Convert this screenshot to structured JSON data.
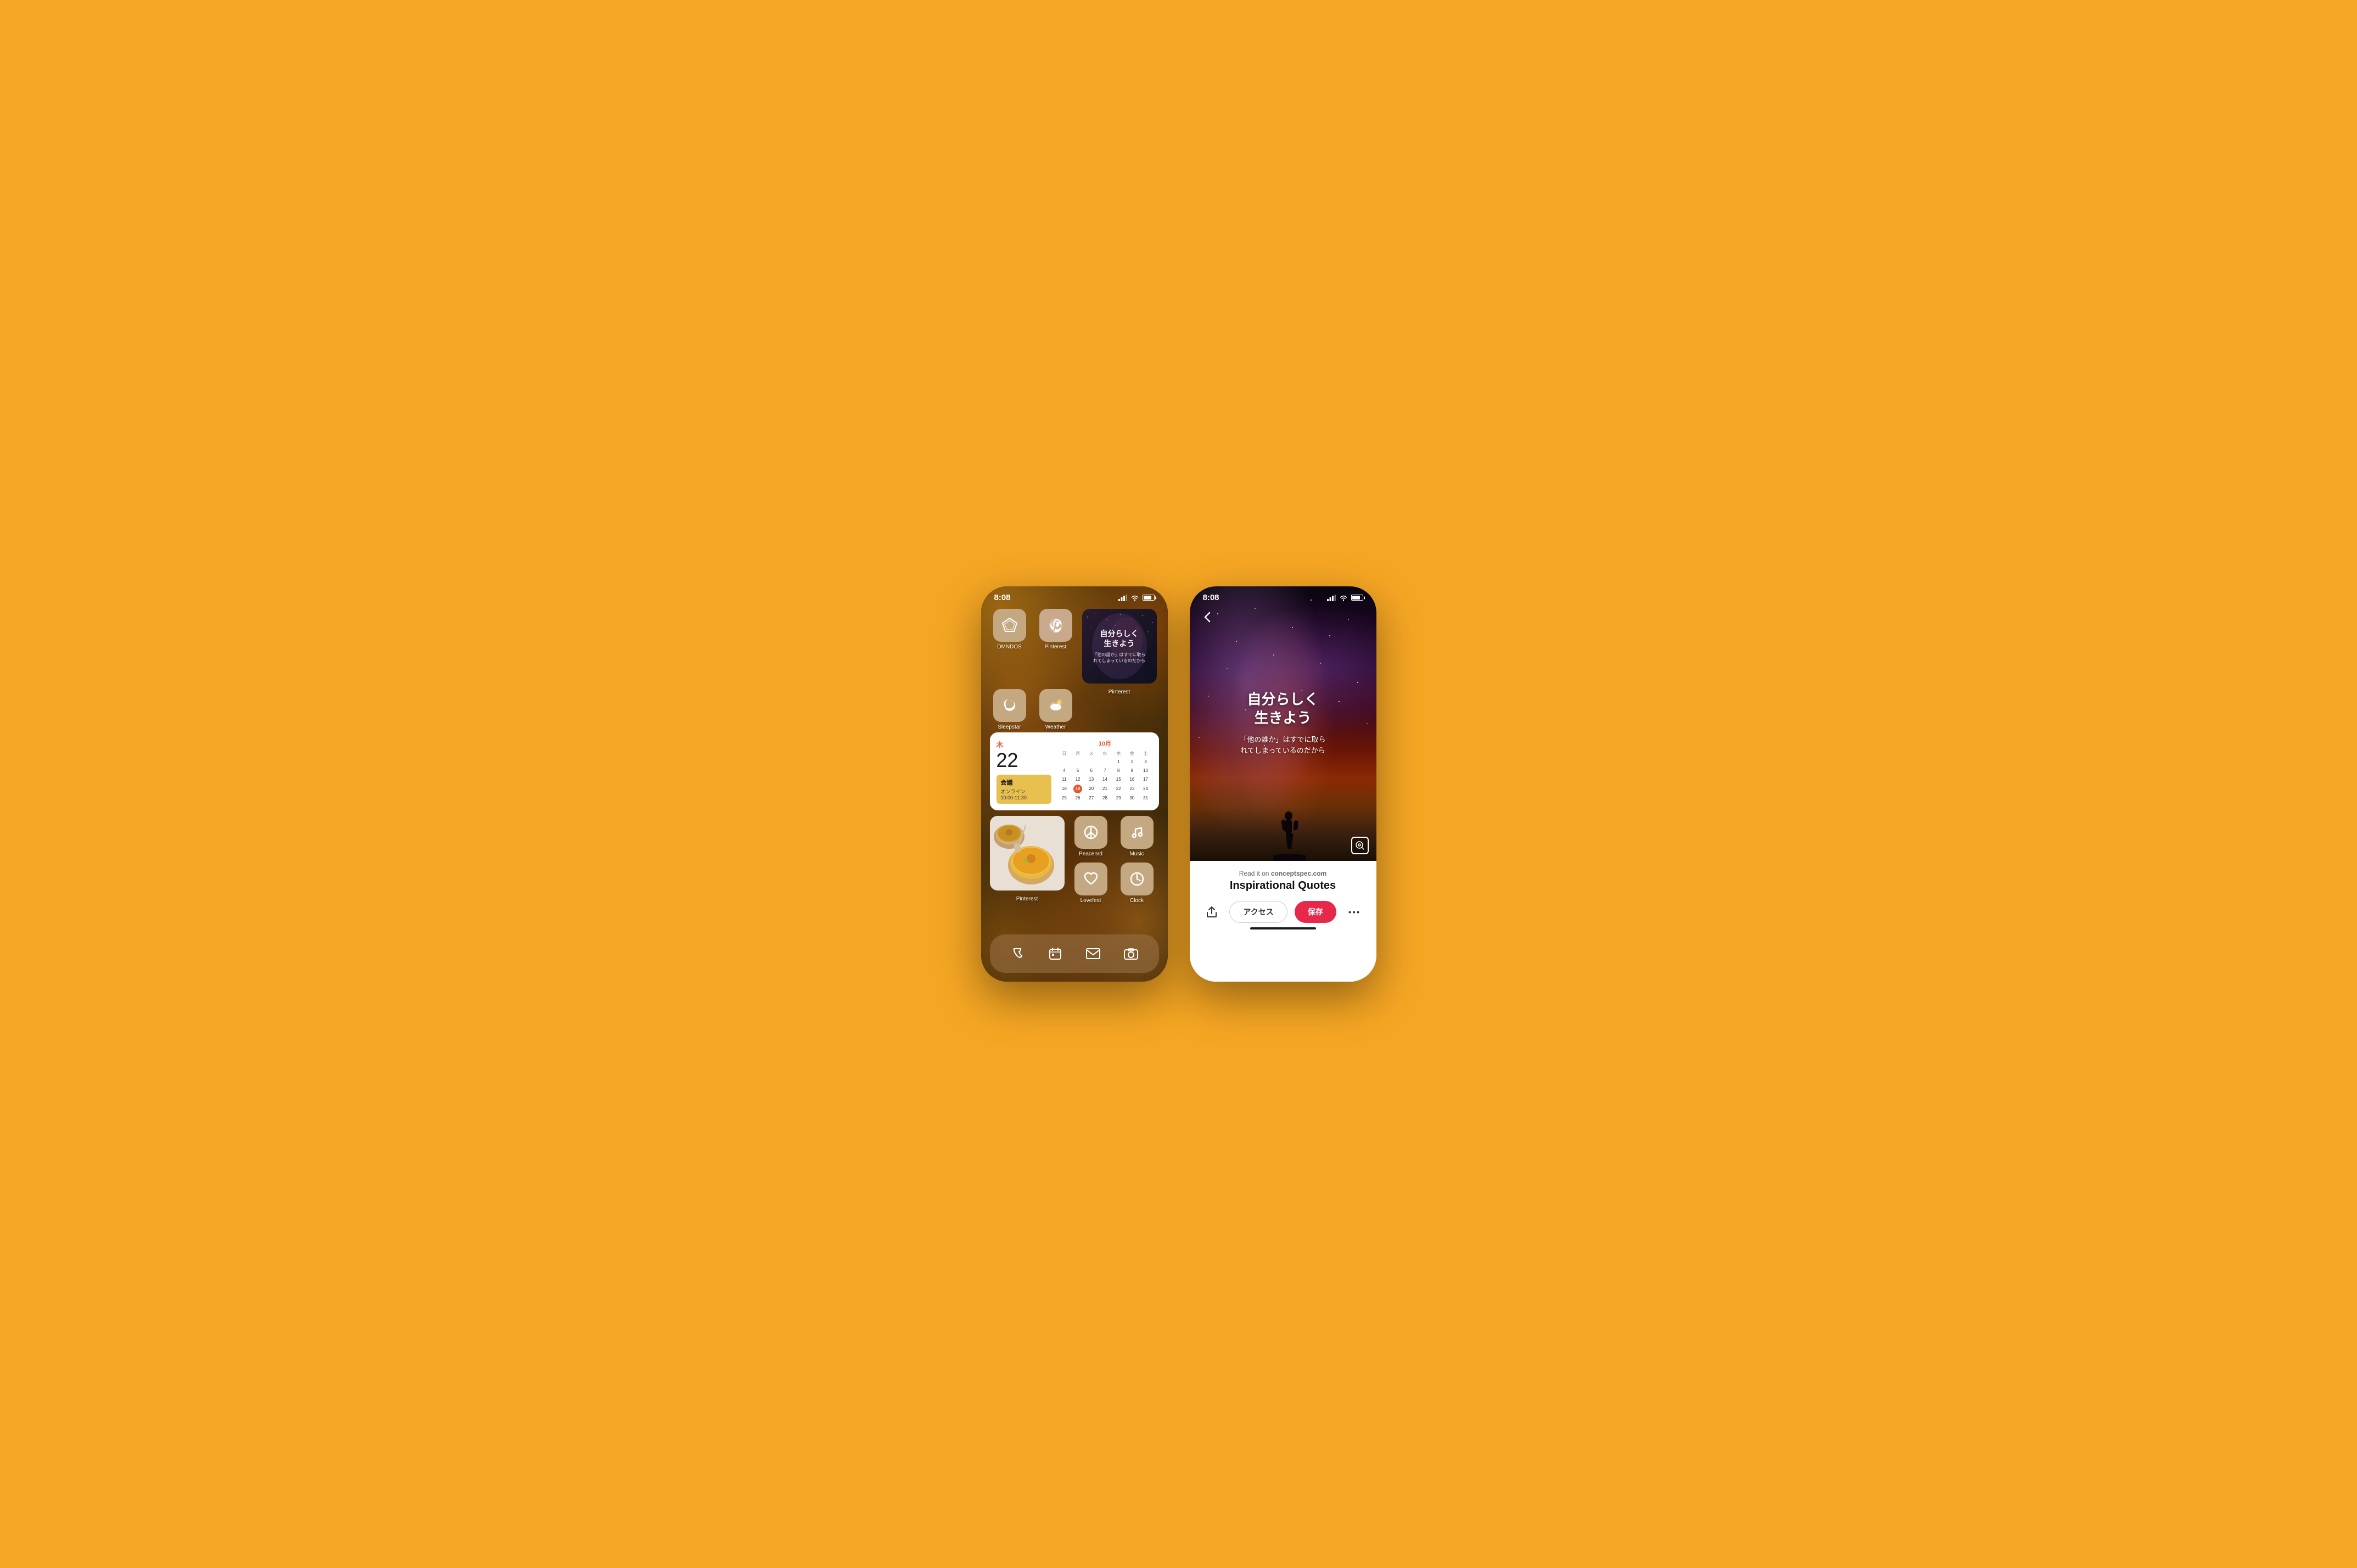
{
  "page": {
    "background_color": "#F5A623"
  },
  "phone1": {
    "status_bar": {
      "time": "8:08",
      "signal": "●●●",
      "wifi": "wifi",
      "battery": "battery"
    },
    "app_row1": [
      {
        "id": "dmndos",
        "label": "DMNDOS",
        "icon": "diamond",
        "bg": "#c4a882"
      },
      {
        "id": "pinterest",
        "label": "Pinterest",
        "icon": "pinterest",
        "bg": "#c9a98b"
      }
    ],
    "pinterest_widget": {
      "main_text": "自分らしく\n生きよう",
      "sub_text": "「他の誰か」はすでに取ら\nれてしまっているのだから",
      "label": "Pinterest"
    },
    "app_row2": [
      {
        "id": "sleepstar",
        "label": "Sleepstar",
        "icon": "moon",
        "bg": "#c4a882"
      },
      {
        "id": "weather",
        "label": "Weather",
        "icon": "cloud-sun",
        "bg": "#c4a882"
      }
    ],
    "calendar_widget": {
      "day_name": "木",
      "day_num": "22",
      "month_header": "10月",
      "event_title": "会議",
      "event_location": "オンライン",
      "event_time": "10:00-11:30",
      "weekdays": [
        "日",
        "月",
        "火",
        "水",
        "木",
        "金",
        "土"
      ],
      "weeks": [
        [
          "",
          "",
          "",
          "",
          "1",
          "2",
          "3"
        ],
        [
          "4",
          "5",
          "6",
          "7",
          "8",
          "9",
          "10"
        ],
        [
          "11",
          "12",
          "13",
          "14",
          "15",
          "16",
          "17"
        ],
        [
          "18",
          "19",
          "20",
          "21",
          "22",
          "23",
          "24"
        ],
        [
          "25",
          "26",
          "27",
          "28",
          "29",
          "30",
          "31"
        ]
      ],
      "today": "19"
    },
    "app_row3": [
      {
        "id": "peacenrd",
        "label": "Peacenrd",
        "icon": "peace",
        "bg": "#c4a882"
      },
      {
        "id": "music",
        "label": "Music",
        "icon": "music",
        "bg": "#c4a882"
      }
    ],
    "app_row4": [
      {
        "id": "lovefest",
        "label": "Lovefest",
        "icon": "heart",
        "bg": "#c4a882"
      },
      {
        "id": "clock",
        "label": "Clock",
        "icon": "clock",
        "bg": "#c4a882"
      }
    ],
    "dock": [
      {
        "id": "phone",
        "icon": "phone"
      },
      {
        "id": "calendar",
        "icon": "calendar"
      },
      {
        "id": "mail",
        "icon": "mail"
      },
      {
        "id": "camera",
        "icon": "camera"
      }
    ]
  },
  "phone2": {
    "status_bar": {
      "time": "8:08"
    },
    "back_label": "‹",
    "quote_main": "自分らしく\n生きよう",
    "quote_sub": "「他の誰か」はすでに取ら\nれてしまっているのだから",
    "source_text": "Read it on",
    "source_site": "conceptspec.com",
    "title": "Inspirational Quotes",
    "actions": {
      "access_label": "アクセス",
      "save_label": "保存"
    }
  }
}
